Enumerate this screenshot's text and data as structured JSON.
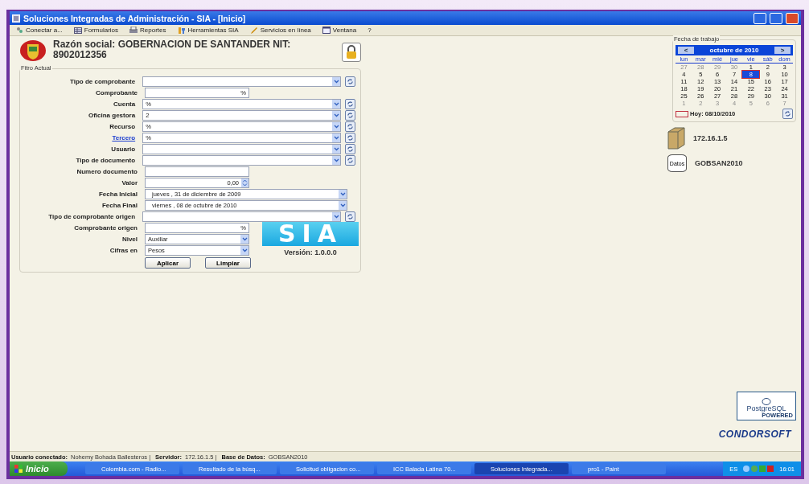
{
  "window": {
    "title": "Soluciones Integradas de Administración - SIA - [Inicio]"
  },
  "menu": [
    {
      "label": "Conectar a..."
    },
    {
      "label": "Formularios"
    },
    {
      "label": "Reportes"
    },
    {
      "label": "Herramientas SIA"
    },
    {
      "label": "Servicios en línea"
    },
    {
      "label": "Ventana"
    },
    {
      "label": "?"
    }
  ],
  "header": {
    "company": "Razón social: GOBERNACION DE SANTANDER NIT:",
    "nit": "8902012356"
  },
  "filter": {
    "title": "Fitro Actual",
    "fields": [
      {
        "label": "Tipo de comprobante",
        "kind": "combo",
        "refresh": true,
        "link": false
      },
      {
        "label": "Comprobante",
        "kind": "text",
        "value": "%",
        "refresh": false,
        "link": false
      },
      {
        "label": "Cuenta",
        "kind": "combo",
        "value": "%",
        "refresh": true,
        "link": false
      },
      {
        "label": "Oficina gestora",
        "kind": "combo",
        "value": "2",
        "refresh": true,
        "link": false
      },
      {
        "label": "Recurso",
        "kind": "combo",
        "value": "%",
        "refresh": true,
        "link": false
      },
      {
        "label": "Tercero",
        "kind": "combo",
        "value": "%",
        "refresh": true,
        "link": true
      },
      {
        "label": "Usuario",
        "kind": "combo",
        "refresh": true,
        "link": false
      },
      {
        "label": "Tipo de documento",
        "kind": "combo",
        "refresh": true,
        "link": false
      },
      {
        "label": "Numero documento",
        "kind": "text",
        "refresh": false,
        "link": false
      },
      {
        "label": "Valor",
        "kind": "spinner",
        "value": "0,00",
        "refresh": false,
        "link": false
      },
      {
        "label": "Fecha Inicial",
        "kind": "date",
        "value": "jueves  , 31 de  diciembre  de 2009",
        "refresh": false,
        "link": false
      },
      {
        "label": "Fecha Final",
        "kind": "date",
        "value": "viernes  , 08 de    octubre    de 2010",
        "refresh": false,
        "link": false
      },
      {
        "label": "Tipo de comprobante origen",
        "kind": "combo",
        "refresh": true,
        "link": false
      },
      {
        "label": "Comprobante origen",
        "kind": "text",
        "value": "%",
        "refresh": false,
        "link": false
      },
      {
        "label": "Nivel",
        "kind": "short_combo",
        "value": "Auxiliar",
        "refresh": false,
        "link": false
      },
      {
        "label": "Cifras en",
        "kind": "short_combo",
        "value": "Pesos",
        "refresh": false,
        "link": false
      }
    ],
    "buttons": [
      "Aplicar",
      "Limpiar"
    ],
    "logo_text": "SIA",
    "version": "Versión: 1.0.0.0"
  },
  "calendar": {
    "title": "Fecha de trabajo",
    "prev": "<",
    "next": ">",
    "month": "octubre de 2010",
    "weekdays": [
      "lun",
      "mar",
      "mié",
      "jue",
      "vie",
      "sáb",
      "dom"
    ],
    "weeks": [
      [
        {
          "d": "27",
          "other": true,
          "selected": false
        },
        {
          "d": "28",
          "other": true,
          "selected": false
        },
        {
          "d": "29",
          "other": true,
          "selected": false
        },
        {
          "d": "30",
          "other": true,
          "selected": false
        },
        {
          "d": "1",
          "other": false,
          "selected": false
        },
        {
          "d": "2",
          "other": false,
          "selected": false
        },
        {
          "d": "3",
          "other": false,
          "selected": false
        }
      ],
      [
        {
          "d": "4",
          "other": false,
          "selected": false
        },
        {
          "d": "5",
          "other": false,
          "selected": false
        },
        {
          "d": "6",
          "other": false,
          "selected": false
        },
        {
          "d": "7",
          "other": false,
          "selected": false
        },
        {
          "d": "8",
          "other": false,
          "selected": true
        },
        {
          "d": "9",
          "other": false,
          "selected": false
        },
        {
          "d": "10",
          "other": false,
          "selected": false
        }
      ],
      [
        {
          "d": "11",
          "other": false,
          "selected": false
        },
        {
          "d": "12",
          "other": false,
          "selected": false
        },
        {
          "d": "13",
          "other": false,
          "selected": false
        },
        {
          "d": "14",
          "other": false,
          "selected": false
        },
        {
          "d": "15",
          "other": false,
          "selected": false
        },
        {
          "d": "16",
          "other": false,
          "selected": false
        },
        {
          "d": "17",
          "other": false,
          "selected": false
        }
      ],
      [
        {
          "d": "18",
          "other": false,
          "selected": false
        },
        {
          "d": "19",
          "other": false,
          "selected": false
        },
        {
          "d": "20",
          "other": false,
          "selected": false
        },
        {
          "d": "21",
          "other": false,
          "selected": false
        },
        {
          "d": "22",
          "other": false,
          "selected": false
        },
        {
          "d": "23",
          "other": false,
          "selected": false
        },
        {
          "d": "24",
          "other": false,
          "selected": false
        }
      ],
      [
        {
          "d": "25",
          "other": false,
          "selected": false
        },
        {
          "d": "26",
          "other": false,
          "selected": false
        },
        {
          "d": "27",
          "other": false,
          "selected": false
        },
        {
          "d": "28",
          "other": false,
          "selected": false
        },
        {
          "d": "29",
          "other": false,
          "selected": false
        },
        {
          "d": "30",
          "other": false,
          "selected": false
        },
        {
          "d": "31",
          "other": false,
          "selected": false
        }
      ],
      [
        {
          "d": "1",
          "other": true,
          "selected": false
        },
        {
          "d": "2",
          "other": true,
          "selected": false
        },
        {
          "d": "3",
          "other": true,
          "selected": false
        },
        {
          "d": "4",
          "other": true,
          "selected": false
        },
        {
          "d": "5",
          "other": true,
          "selected": false
        },
        {
          "d": "6",
          "other": true,
          "selected": false
        },
        {
          "d": "7",
          "other": true,
          "selected": false
        }
      ]
    ],
    "today": "Hoy: 08/10/2010"
  },
  "server": {
    "address": "172.16.1.5"
  },
  "database": {
    "icon_label": "Datos",
    "name": "GOBSAN2010"
  },
  "logos": {
    "postgres": "PostgreSQL",
    "postgres_sub": "POWERED",
    "condorsoft": "CONDORSOFT"
  },
  "status_bar": [
    {
      "label": "Usuario conectado:",
      "value": "Nohemy Bohada Ballesteros |"
    },
    {
      "label": "Servidor:",
      "value": "172.16.1.5 |"
    },
    {
      "label": "Base de Datos:",
      "value": "GOBSAN2010"
    }
  ],
  "taskbar": {
    "start": "Inicio",
    "tasks": [
      {
        "label": "Colombia.com - Radio...",
        "selected": false
      },
      {
        "label": "Resultado de la búsq...",
        "selected": false
      },
      {
        "label": "Solicitud obligacion co...",
        "selected": false
      },
      {
        "label": "ICC Balada Latina 70...",
        "selected": false
      },
      {
        "label": "Soluciones Integrada...",
        "selected": true
      },
      {
        "label": "pro1 - Paint",
        "selected": false
      }
    ],
    "language": "ES",
    "clock": "16:01"
  }
}
